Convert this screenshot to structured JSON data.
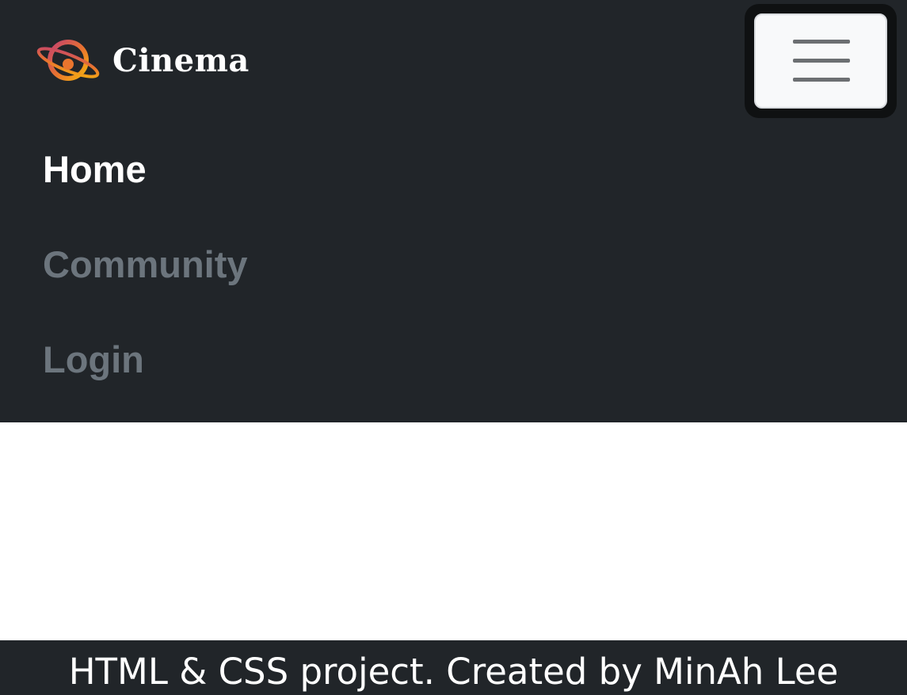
{
  "navbar": {
    "brand": {
      "name": "Cinema",
      "logo_icon": "planet-logo-icon"
    },
    "toggler_icon": "hamburger-menu-icon",
    "items": [
      {
        "label": "Home",
        "active": true
      },
      {
        "label": "Community",
        "active": false
      },
      {
        "label": "Login",
        "active": false
      }
    ]
  },
  "footer": {
    "text": "HTML & CSS project. Created by MinAh Lee"
  },
  "colors": {
    "navbar_bg": "#212529",
    "active_link": "#ffffff",
    "inactive_link": "#6c757d",
    "logo_gradient": [
      "#c2406f",
      "#f5b50e"
    ]
  }
}
